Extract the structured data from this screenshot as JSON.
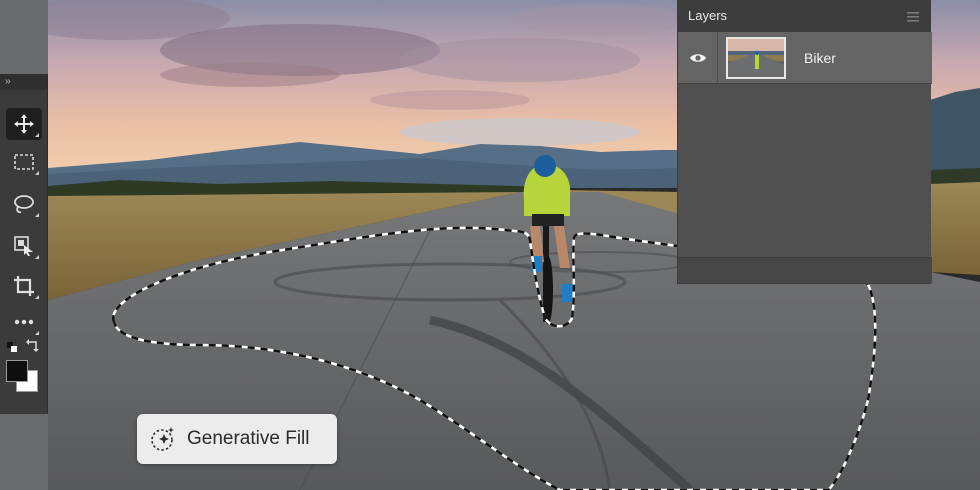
{
  "toolbar": {
    "tools": [
      {
        "name": "move-tool",
        "active": true
      },
      {
        "name": "marquee-tool",
        "active": false
      },
      {
        "name": "lasso-tool",
        "active": false
      },
      {
        "name": "object-select-tool",
        "active": false
      },
      {
        "name": "crop-tool",
        "active": false
      },
      {
        "name": "more-tools",
        "active": false
      }
    ],
    "foreground_color": "#0e0e0e",
    "background_color": "#ffffff"
  },
  "layers_panel": {
    "title": "Layers",
    "layers": [
      {
        "name": "Biker",
        "visible": true
      }
    ]
  },
  "generative_fill": {
    "label": "Generative Fill"
  },
  "colors": {
    "panel_bg": "#505050",
    "toolbar_bg": "#3b3b3b",
    "button_bg": "#ececec"
  }
}
